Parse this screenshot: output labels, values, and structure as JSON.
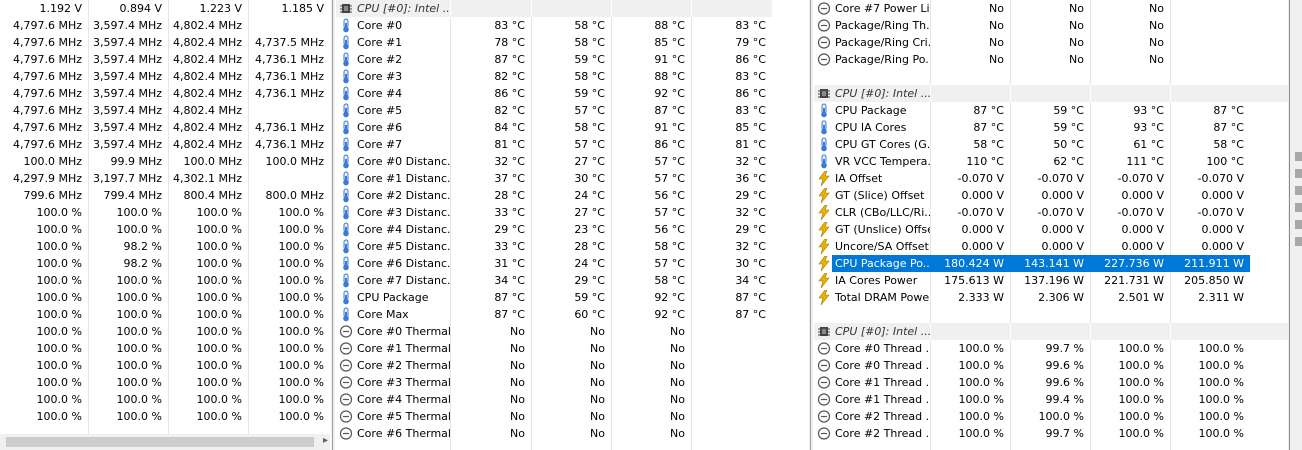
{
  "left": {
    "rows": [
      [
        "1.192 V",
        "0.894 V",
        "1.223 V",
        "1.185 V"
      ],
      [
        "4,797.6 MHz",
        "3,597.4 MHz",
        "4,802.4 MHz",
        ""
      ],
      [
        "4,797.6 MHz",
        "3,597.4 MHz",
        "4,802.4 MHz",
        "4,737.5 MHz"
      ],
      [
        "4,797.6 MHz",
        "3,597.4 MHz",
        "4,802.4 MHz",
        "4,736.1 MHz"
      ],
      [
        "4,797.6 MHz",
        "3,597.4 MHz",
        "4,802.4 MHz",
        "4,736.1 MHz"
      ],
      [
        "4,797.6 MHz",
        "3,597.4 MHz",
        "4,802.4 MHz",
        "4,736.1 MHz"
      ],
      [
        "4,797.6 MHz",
        "3,597.4 MHz",
        "4,802.4 MHz",
        ""
      ],
      [
        "4,797.6 MHz",
        "3,597.4 MHz",
        "4,802.4 MHz",
        "4,736.1 MHz"
      ],
      [
        "4,797.6 MHz",
        "3,597.4 MHz",
        "4,802.4 MHz",
        "4,736.1 MHz"
      ],
      [
        "100.0 MHz",
        "99.9 MHz",
        "100.0 MHz",
        "100.0 MHz"
      ],
      [
        "4,297.9 MHz",
        "3,197.7 MHz",
        "4,302.1 MHz",
        ""
      ],
      [
        "799.6 MHz",
        "799.4 MHz",
        "800.4 MHz",
        "800.0 MHz"
      ],
      [
        "100.0 %",
        "100.0 %",
        "100.0 %",
        "100.0 %"
      ],
      [
        "100.0 %",
        "100.0 %",
        "100.0 %",
        "100.0 %"
      ],
      [
        "100.0 %",
        "98.2 %",
        "100.0 %",
        "100.0 %"
      ],
      [
        "100.0 %",
        "98.2 %",
        "100.0 %",
        "100.0 %"
      ],
      [
        "100.0 %",
        "100.0 %",
        "100.0 %",
        "100.0 %"
      ],
      [
        "100.0 %",
        "100.0 %",
        "100.0 %",
        "100.0 %"
      ],
      [
        "100.0 %",
        "100.0 %",
        "100.0 %",
        "100.0 %"
      ],
      [
        "100.0 %",
        "100.0 %",
        "100.0 %",
        "100.0 %"
      ],
      [
        "100.0 %",
        "100.0 %",
        "100.0 %",
        "100.0 %"
      ],
      [
        "100.0 %",
        "100.0 %",
        "100.0 %",
        "100.0 %"
      ],
      [
        "100.0 %",
        "100.0 %",
        "100.0 %",
        "100.0 %"
      ],
      [
        "100.0 %",
        "100.0 %",
        "100.0 %",
        "100.0 %"
      ],
      [
        "100.0 %",
        "100.0 %",
        "100.0 %",
        "100.0 %"
      ]
    ]
  },
  "middle": {
    "rows": [
      {
        "type": "header",
        "name": "CPU [#0]: Intel ..."
      },
      {
        "icon": "thermometer",
        "name": "Core #0",
        "values": [
          "83 °C",
          "58 °C",
          "88 °C",
          "83 °C"
        ]
      },
      {
        "icon": "thermometer",
        "name": "Core #1",
        "values": [
          "78 °C",
          "58 °C",
          "85 °C",
          "79 °C"
        ]
      },
      {
        "icon": "thermometer",
        "name": "Core #2",
        "values": [
          "87 °C",
          "59 °C",
          "91 °C",
          "86 °C"
        ]
      },
      {
        "icon": "thermometer",
        "name": "Core #3",
        "values": [
          "82 °C",
          "58 °C",
          "88 °C",
          "83 °C"
        ]
      },
      {
        "icon": "thermometer",
        "name": "Core #4",
        "values": [
          "86 °C",
          "59 °C",
          "92 °C",
          "86 °C"
        ]
      },
      {
        "icon": "thermometer",
        "name": "Core #5",
        "values": [
          "82 °C",
          "57 °C",
          "87 °C",
          "83 °C"
        ]
      },
      {
        "icon": "thermometer",
        "name": "Core #6",
        "values": [
          "84 °C",
          "58 °C",
          "91 °C",
          "85 °C"
        ]
      },
      {
        "icon": "thermometer",
        "name": "Core #7",
        "values": [
          "81 °C",
          "57 °C",
          "86 °C",
          "81 °C"
        ]
      },
      {
        "icon": "thermometer",
        "name": "Core #0 Distanc...",
        "values": [
          "32 °C",
          "27 °C",
          "57 °C",
          "32 °C"
        ]
      },
      {
        "icon": "thermometer",
        "name": "Core #1 Distanc...",
        "values": [
          "37 °C",
          "30 °C",
          "57 °C",
          "36 °C"
        ]
      },
      {
        "icon": "thermometer",
        "name": "Core #2 Distanc...",
        "values": [
          "28 °C",
          "24 °C",
          "56 °C",
          "29 °C"
        ]
      },
      {
        "icon": "thermometer",
        "name": "Core #3 Distanc...",
        "values": [
          "33 °C",
          "27 °C",
          "57 °C",
          "32 °C"
        ]
      },
      {
        "icon": "thermometer",
        "name": "Core #4 Distanc...",
        "values": [
          "29 °C",
          "23 °C",
          "56 °C",
          "29 °C"
        ]
      },
      {
        "icon": "thermometer",
        "name": "Core #5 Distanc...",
        "values": [
          "33 °C",
          "28 °C",
          "58 °C",
          "32 °C"
        ]
      },
      {
        "icon": "thermometer",
        "name": "Core #6 Distanc...",
        "values": [
          "31 °C",
          "24 °C",
          "57 °C",
          "30 °C"
        ]
      },
      {
        "icon": "thermometer",
        "name": "Core #7 Distanc...",
        "values": [
          "34 °C",
          "29 °C",
          "58 °C",
          "34 °C"
        ]
      },
      {
        "icon": "thermometer",
        "name": "CPU Package",
        "values": [
          "87 °C",
          "59 °C",
          "92 °C",
          "87 °C"
        ]
      },
      {
        "icon": "thermometer",
        "name": "Core Max",
        "values": [
          "87 °C",
          "60 °C",
          "92 °C",
          "87 °C"
        ]
      },
      {
        "icon": "circle-minus",
        "name": "Core #0 Thermal...",
        "values": [
          "No",
          "No",
          "No",
          ""
        ]
      },
      {
        "icon": "circle-minus",
        "name": "Core #1 Thermal...",
        "values": [
          "No",
          "No",
          "No",
          ""
        ]
      },
      {
        "icon": "circle-minus",
        "name": "Core #2 Thermal...",
        "values": [
          "No",
          "No",
          "No",
          ""
        ]
      },
      {
        "icon": "circle-minus",
        "name": "Core #3 Thermal...",
        "values": [
          "No",
          "No",
          "No",
          ""
        ]
      },
      {
        "icon": "circle-minus",
        "name": "Core #4 Thermal...",
        "values": [
          "No",
          "No",
          "No",
          ""
        ]
      },
      {
        "icon": "circle-minus",
        "name": "Core #5 Thermal...",
        "values": [
          "No",
          "No",
          "No",
          ""
        ]
      },
      {
        "icon": "circle-minus",
        "name": "Core #6 Thermal...",
        "values": [
          "No",
          "No",
          "No",
          ""
        ]
      }
    ]
  },
  "right": {
    "rows": [
      {
        "icon": "circle-minus",
        "name": "Core #7 Power Li...",
        "values": [
          "No",
          "No",
          "No",
          ""
        ]
      },
      {
        "icon": "circle-minus",
        "name": "Package/Ring Th...",
        "values": [
          "No",
          "No",
          "No",
          ""
        ]
      },
      {
        "icon": "circle-minus",
        "name": "Package/Ring Cri...",
        "values": [
          "No",
          "No",
          "No",
          ""
        ]
      },
      {
        "icon": "circle-minus",
        "name": "Package/Ring Po...",
        "values": [
          "No",
          "No",
          "No",
          ""
        ]
      },
      {
        "type": "blank"
      },
      {
        "type": "header",
        "name": "CPU [#0]: Intel ..."
      },
      {
        "icon": "thermometer",
        "name": "CPU Package",
        "values": [
          "87 °C",
          "59 °C",
          "93 °C",
          "87 °C"
        ]
      },
      {
        "icon": "thermometer",
        "name": "CPU IA Cores",
        "values": [
          "87 °C",
          "59 °C",
          "93 °C",
          "87 °C"
        ]
      },
      {
        "icon": "thermometer",
        "name": "CPU GT Cores (G...",
        "values": [
          "58 °C",
          "50 °C",
          "61 °C",
          "58 °C"
        ]
      },
      {
        "icon": "thermometer",
        "name": "VR VCC Tempera...",
        "values": [
          "110 °C",
          "62 °C",
          "111 °C",
          "100 °C"
        ]
      },
      {
        "icon": "lightning",
        "name": "IA Offset",
        "values": [
          "-0.070 V",
          "-0.070 V",
          "-0.070 V",
          "-0.070 V"
        ]
      },
      {
        "icon": "lightning",
        "name": "GT (Slice) Offset",
        "values": [
          "0.000 V",
          "0.000 V",
          "0.000 V",
          "0.000 V"
        ]
      },
      {
        "icon": "lightning",
        "name": "CLR (CBo/LLC/Ri...",
        "values": [
          "-0.070 V",
          "-0.070 V",
          "-0.070 V",
          "-0.070 V"
        ]
      },
      {
        "icon": "lightning",
        "name": "GT (Unslice) Offset",
        "values": [
          "0.000 V",
          "0.000 V",
          "0.000 V",
          "0.000 V"
        ]
      },
      {
        "icon": "lightning",
        "name": "Uncore/SA Offset",
        "values": [
          "0.000 V",
          "0.000 V",
          "0.000 V",
          "0.000 V"
        ]
      },
      {
        "icon": "lightning",
        "name": "CPU Package Po...",
        "values": [
          "180.424 W",
          "143.141 W",
          "227.736 W",
          "211.911 W"
        ],
        "selected": true
      },
      {
        "icon": "lightning",
        "name": "IA Cores Power",
        "values": [
          "175.613 W",
          "137.196 W",
          "221.731 W",
          "205.850 W"
        ]
      },
      {
        "icon": "lightning",
        "name": "Total DRAM Power",
        "values": [
          "2.333 W",
          "2.306 W",
          "2.501 W",
          "2.311 W"
        ]
      },
      {
        "type": "blank"
      },
      {
        "type": "header",
        "name": "CPU [#0]: Intel ..."
      },
      {
        "icon": "circle-minus",
        "name": "Core #0 Thread ...",
        "values": [
          "100.0 %",
          "99.7 %",
          "100.0 %",
          "100.0 %"
        ]
      },
      {
        "icon": "circle-minus",
        "name": "Core #0 Thread ...",
        "values": [
          "100.0 %",
          "99.6 %",
          "100.0 %",
          "100.0 %"
        ]
      },
      {
        "icon": "circle-minus",
        "name": "Core #1 Thread ...",
        "values": [
          "100.0 %",
          "99.6 %",
          "100.0 %",
          "100.0 %"
        ]
      },
      {
        "icon": "circle-minus",
        "name": "Core #1 Thread ...",
        "values": [
          "100.0 %",
          "99.4 %",
          "100.0 %",
          "100.0 %"
        ]
      },
      {
        "icon": "circle-minus",
        "name": "Core #2 Thread ...",
        "values": [
          "100.0 %",
          "100.0 %",
          "100.0 %",
          "100.0 %"
        ]
      },
      {
        "icon": "circle-minus",
        "name": "Core #2 Thread ...",
        "values": [
          "100.0 %",
          "99.7 %",
          "100.0 %",
          "100.0 %"
        ]
      }
    ]
  },
  "colors": {
    "selected_row": "#0078d7",
    "header_row": "#f0f0f0",
    "thermometer": "#3a7bd5",
    "lightning": "#e8b400",
    "circle_icon": "#555555"
  }
}
